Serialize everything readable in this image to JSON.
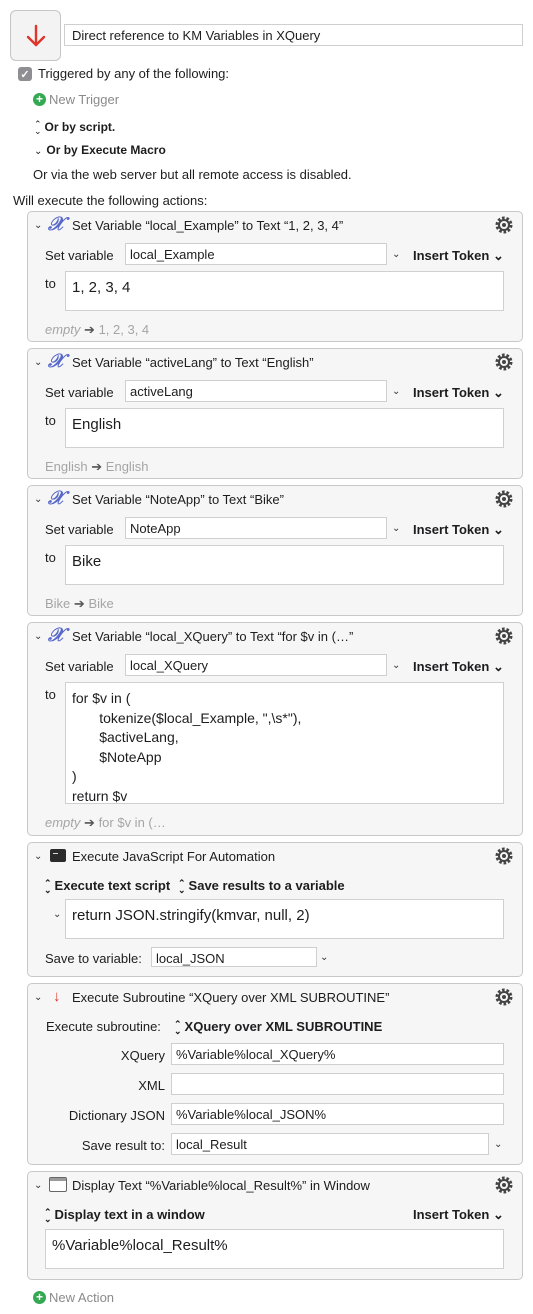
{
  "macro": {
    "icon": "down-arrow-icon",
    "title": "Direct reference to KM Variables in XQuery"
  },
  "triggers": {
    "header": "Triggered by any of the following:",
    "new_trigger": "New Trigger",
    "or_by_script": "Or by script.",
    "or_by_execute_macro": "Or by Execute Macro",
    "web_server_note": "Or via the web server but all remote access is disabled."
  },
  "actions_header": "Will execute the following actions:",
  "actions": [
    {
      "title": "Set Variable “local_Example” to Text “1, 2, 3, 4”",
      "set_variable_label": "Set variable",
      "variable": "local_Example",
      "insert_token": "Insert Token",
      "to_label": "to",
      "text": "1, 2, 3, 4",
      "status_from": "empty",
      "status_to": "1, 2, 3, 4"
    },
    {
      "title": "Set Variable “activeLang” to Text “English”",
      "set_variable_label": "Set variable",
      "variable": "activeLang",
      "insert_token": "Insert Token",
      "to_label": "to",
      "text": "English",
      "status_from": "English",
      "status_to": "English"
    },
    {
      "title": "Set Variable “NoteApp” to Text “Bike”",
      "set_variable_label": "Set variable",
      "variable": "NoteApp",
      "insert_token": "Insert Token",
      "to_label": "to",
      "text": "Bike",
      "status_from": "Bike",
      "status_to": "Bike"
    },
    {
      "title": "Set Variable “local_XQuery” to Text “for $v in (…”",
      "set_variable_label": "Set variable",
      "variable": "local_XQuery",
      "insert_token": "Insert Token",
      "to_label": "to",
      "text": "for $v in (\n       tokenize($local_Example, \",\\s*\"),\n       $activeLang,\n       $NoteApp\n)\nreturn $v",
      "status_from": "empty",
      "status_to": "for $v in (…"
    },
    {
      "title": "Execute JavaScript For Automation",
      "execute_mode": "Execute text script",
      "results_mode": "Save results to a variable",
      "script": "return JSON.stringify(kmvar, null, 2)",
      "save_to_label": "Save to variable:",
      "save_to": "local_JSON"
    },
    {
      "title": "Execute Subroutine “XQuery over XML SUBROUTINE”",
      "subroutine_label": "Execute subroutine:",
      "subroutine": "XQuery over XML SUBROUTINE",
      "params": [
        {
          "label": "XQuery",
          "value": "%Variable%local_XQuery%"
        },
        {
          "label": "XML",
          "value": ""
        },
        {
          "label": "Dictionary JSON",
          "value": "%Variable%local_JSON%"
        }
      ],
      "save_result_label": "Save result to:",
      "save_result": "local_Result"
    },
    {
      "title": "Display Text “%Variable%local_Result%” in Window",
      "display_mode": "Display text in a window",
      "insert_token": "Insert Token",
      "text": "%Variable%local_Result%"
    }
  ],
  "new_action": "New Action",
  "colors": {
    "accent_red": "#e0352b",
    "variable_icon": "#5868c9",
    "plus_green": "#34a853"
  }
}
